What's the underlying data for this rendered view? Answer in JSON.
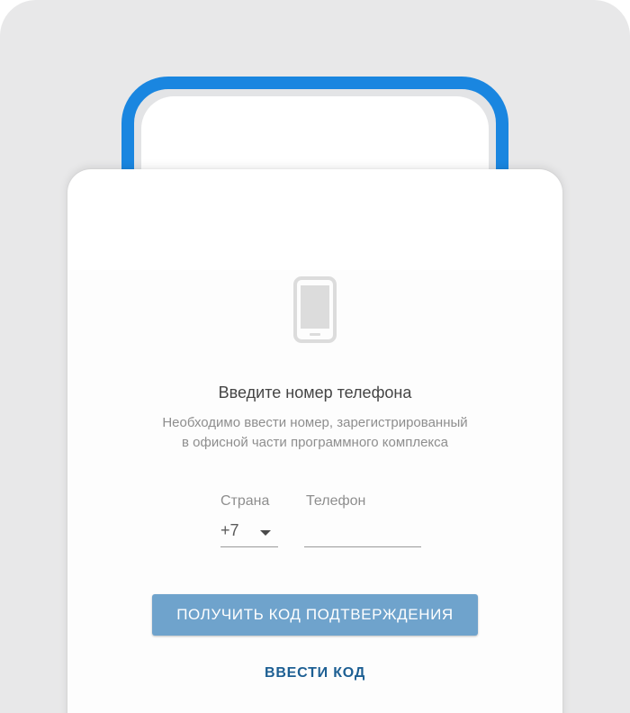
{
  "colors": {
    "background": "#e8e8e9",
    "phone_frame": "#1a86e0",
    "primary_button": "#6fa3cc",
    "link": "#1d5f93"
  },
  "auth": {
    "icon": "smartphone-icon",
    "title": "Введите номер телефона",
    "subtitle_line1": "Необходимо ввести номер, зарегистрированный",
    "subtitle_line2": "в офисной части программного комплекса",
    "country_label": "Страна",
    "country_value": "+7",
    "phone_label": "Телефон",
    "phone_value": "",
    "get_code_button": "ПОЛУЧИТЬ КОД ПОДТВЕРЖДЕНИЯ",
    "enter_code_button": "ВВЕСТИ КОД"
  }
}
